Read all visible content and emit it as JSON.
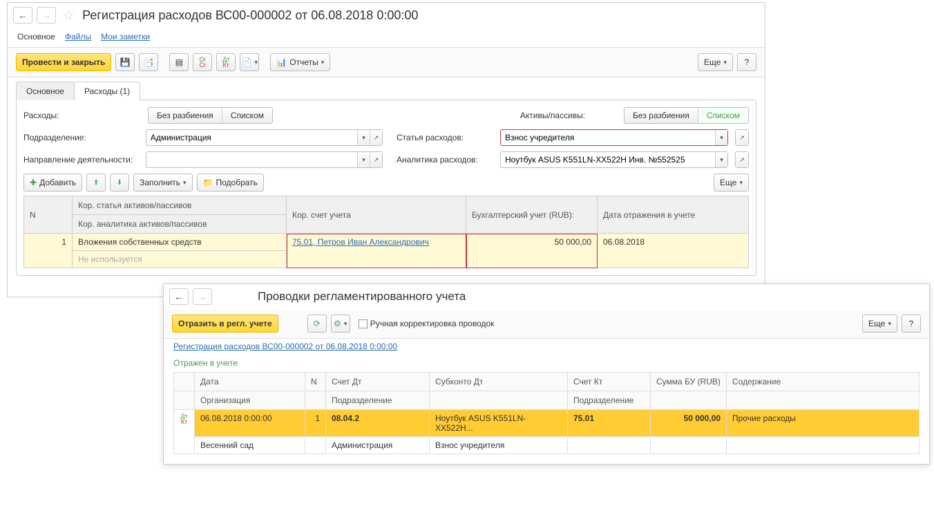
{
  "w1": {
    "title": "Регистрация расходов ВС00-000002 от 06.08.2018 0:00:00",
    "nav_tabs": {
      "main": "Основное",
      "files": "Файлы",
      "notes": "Мои заметки"
    },
    "toolbar": {
      "post_close": "Провести и закрыть",
      "reports": "Отчеты",
      "more": "Еще",
      "help": "?"
    },
    "inner_tabs": {
      "main": "Основное",
      "expenses": "Расходы (1)"
    },
    "form": {
      "expenses_label": "Расходы:",
      "seg_nosplit": "Без разбиения",
      "seg_list": "Списком",
      "assets_label": "Активы/пассивы:",
      "dept_label": "Подразделение:",
      "dept_value": "Администрация",
      "item_label": "Статья расходов:",
      "item_value": "Взнос учредителя",
      "direction_label": "Направление деятельности:",
      "direction_value": "",
      "analytics_label": "Аналитика расходов:",
      "analytics_value": "Ноутбук ASUS K551LN-XX522H Инв. №552525"
    },
    "table_toolbar": {
      "add": "Добавить",
      "fill": "Заполнить",
      "pick": "Подобрать",
      "more": "Еще"
    },
    "table": {
      "headers": {
        "n": "N",
        "corr_item": "Кор. статья активов/пассивов",
        "corr_an": "Кор. аналитика активов/пассивов",
        "corr_acc": "Кор. счет учета",
        "acc_rub": "Бухгалтерский учет (RUB):",
        "date": "Дата отражения в учете"
      },
      "row": {
        "n": "1",
        "corr_item": "Вложения собственных средств",
        "corr_an": "Не используется",
        "corr_acc": "75.01, Петров Иван Александрович",
        "acc_rub": "50 000,00",
        "date": "06.08.2018"
      }
    }
  },
  "w2": {
    "title": "Проводки регламентированного учета",
    "toolbar": {
      "reflect": "Отразить в регл. учете",
      "manual": "Ручная корректировка проводок",
      "more": "Еще",
      "help": "?"
    },
    "doc_link": "Регистрация расходов ВС00-000002 от 06.08.2018 0:00:00",
    "status": "Отражен в учете",
    "table": {
      "headers": {
        "date": "Дата",
        "org": "Организация",
        "n": "N",
        "acc_dt": "Счет Дт",
        "dept_dt": "Подразделение",
        "sub_dt": "Субконто Дт",
        "acc_kt": "Счет Кт",
        "dept_kt": "Подразделение",
        "sum": "Сумма БУ (RUB)",
        "content": "Содержание"
      },
      "r1": {
        "date": "06.08.2018 0:00:00",
        "n": "1",
        "acc_dt": "08.04.2",
        "sub_dt": "Ноутбук ASUS K551LN-XX522H...",
        "acc_kt": "75.01",
        "sum": "50 000,00",
        "content": "Прочие расходы"
      },
      "r2": {
        "org": "Весенний сад",
        "dept_dt": "Администрация",
        "sub_dt2": "Взнос учредителя"
      }
    }
  }
}
